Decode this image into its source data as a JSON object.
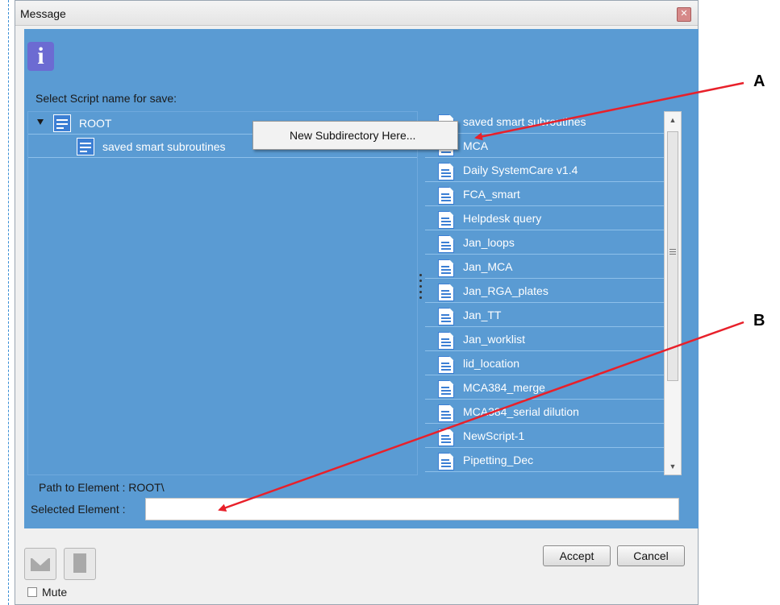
{
  "window": {
    "title": "Message",
    "close_glyph": "✕"
  },
  "info_icon": {
    "glyph": "i",
    "name": "info-icon"
  },
  "prompt": "Select Script name for save:",
  "tree": {
    "root_label": "ROOT",
    "child_label": "saved smart subroutines"
  },
  "context_menu": {
    "item": "New Subdirectory Here..."
  },
  "file_list": {
    "items": [
      "saved smart subroutines",
      "MCA",
      "Daily SystemCare v1.4",
      "FCA_smart",
      "Helpdesk query",
      "Jan_loops",
      "Jan_MCA",
      "Jan_RGA_plates",
      "Jan_TT",
      "Jan_worklist",
      "lid_location",
      "MCA384_merge",
      "MCA384_serial dilution",
      "NewScript-1",
      "Pipetting_Dec"
    ]
  },
  "path": {
    "label": "Path to Element :",
    "value": "ROOT\\"
  },
  "selected": {
    "label": "Selected Element :",
    "value": ""
  },
  "buttons": {
    "accept": "Accept",
    "cancel": "Cancel"
  },
  "mute": {
    "label": "Mute",
    "checked": false
  },
  "callouts": {
    "a": "A",
    "b": "B"
  },
  "colors": {
    "panel_blue": "#5a9bd3",
    "info_purple": "#6c6bd2",
    "arrow_red": "#e8202a"
  }
}
